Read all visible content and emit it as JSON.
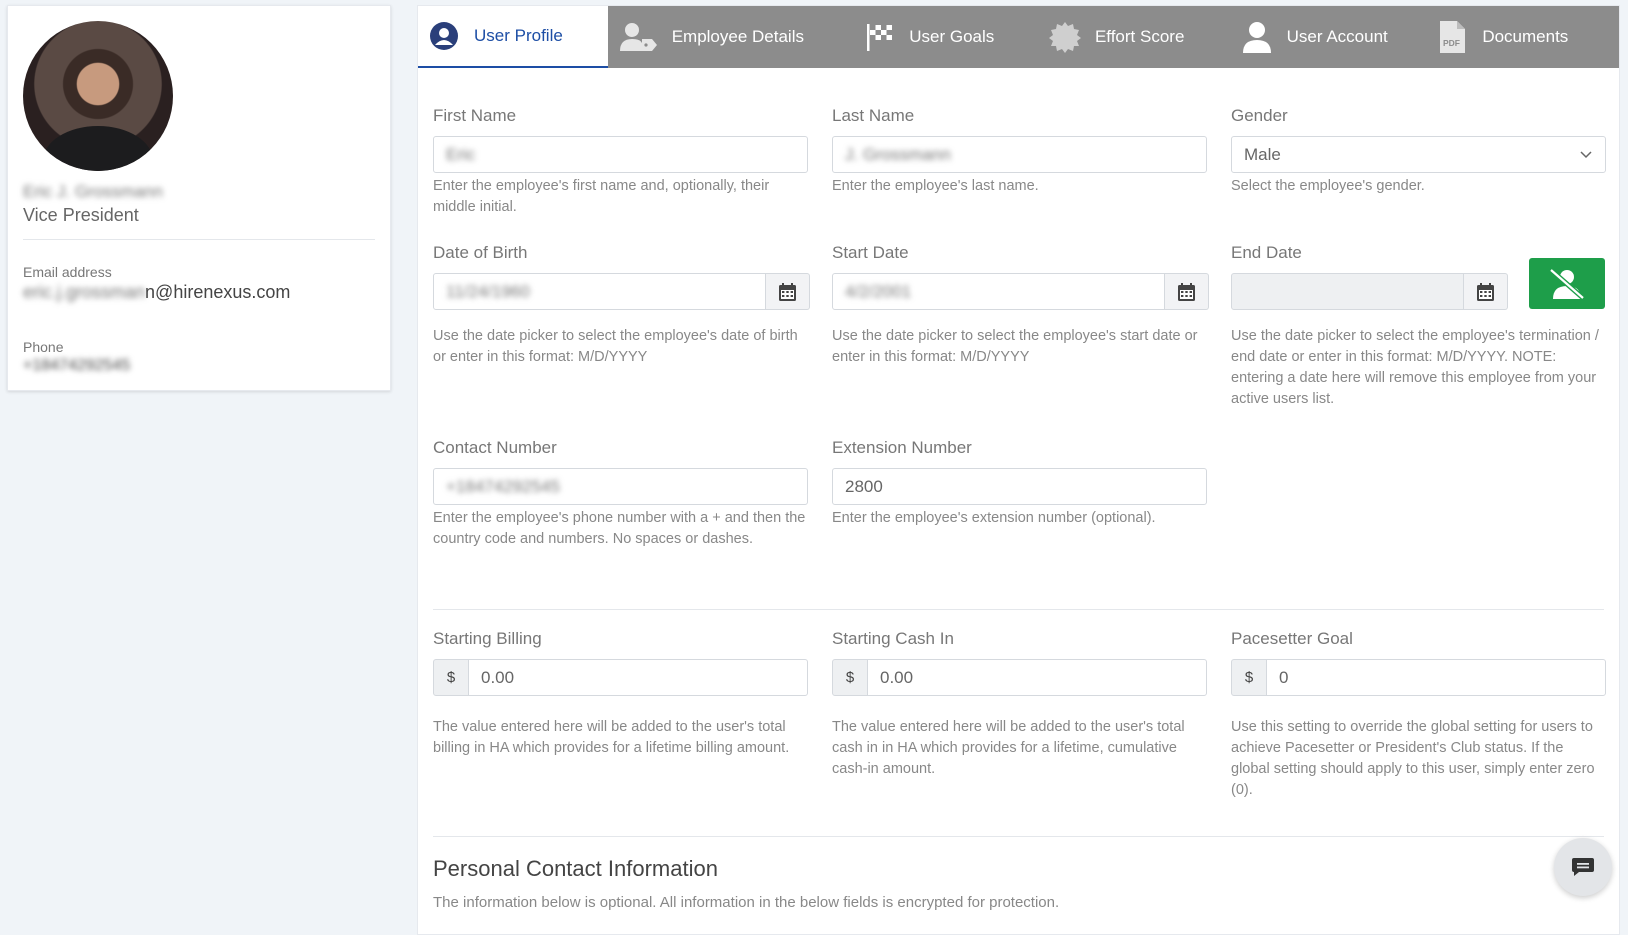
{
  "profile": {
    "name": "Eric J. Grossmann",
    "title": "Vice President",
    "email_label": "Email address",
    "email_blurred": "eric.j.grossman",
    "email_domain": "n@hirenexus.com",
    "phone_label": "Phone",
    "phone": "+18474292545"
  },
  "tabs": [
    {
      "label": "User Profile",
      "icon": "user-circle-icon"
    },
    {
      "label": "Employee Details",
      "icon": "user-tag-icon"
    },
    {
      "label": "User Goals",
      "icon": "flag-checkered-icon"
    },
    {
      "label": "Effort Score",
      "icon": "badge-icon"
    },
    {
      "label": "User Account",
      "icon": "user-icon"
    },
    {
      "label": "Documents",
      "icon": "pdf-file-icon"
    }
  ],
  "form": {
    "first_name": {
      "label": "First Name",
      "value": "Eric",
      "help": "Enter the employee's first name and, optionally, their middle initial."
    },
    "last_name": {
      "label": "Last Name",
      "value": "J. Grossmann",
      "help": "Enter the employee's last name."
    },
    "gender": {
      "label": "Gender",
      "value": "Male",
      "help": "Select the employee's gender."
    },
    "dob": {
      "label": "Date of Birth",
      "value": "11/24/1960",
      "help": "Use the date picker to select the employee's date of birth or enter in this format: M/D/YYYY"
    },
    "start_date": {
      "label": "Start Date",
      "value": "4/2/2001",
      "help": "Use the date picker to select the employee's start date or enter in this format: M/D/YYYY"
    },
    "end_date": {
      "label": "End Date",
      "value": "",
      "help": "Use the date picker to select the employee's termination / end date or enter in this format: M/D/YYYY. NOTE: entering a date here will remove this employee from your active users list."
    },
    "contact": {
      "label": "Contact Number",
      "value": "+18474292545",
      "help": "Enter the employee's phone number with a + and then the country code and numbers. No spaces or dashes."
    },
    "extension": {
      "label": "Extension Number",
      "value": "2800",
      "help": "Enter the employee's extension number (optional)."
    },
    "billing": {
      "label": "Starting Billing",
      "addon": "$",
      "value": "0.00",
      "help": "The value entered here will be added to the user's total billing in HA which provides for a lifetime billing amount."
    },
    "cash_in": {
      "label": "Starting Cash In",
      "addon": "$",
      "value": "0.00",
      "help": "The value entered here will be added to the user's total cash in in HA which provides for a lifetime, cumulative cash-in amount."
    },
    "pacesetter": {
      "label": "Pacesetter Goal",
      "addon": "$",
      "value": "0",
      "help": "Use this setting to override the global setting for users to achieve Pacesetter or President's Club status. If the global setting should apply to this user, simply enter zero (0)."
    }
  },
  "section": {
    "title": "Personal Contact Information",
    "subtitle": "The information below is optional. All information in the below fields is encrypted for protection."
  },
  "colors": {
    "accent": "#1d4ea5",
    "tab_bar": "#8c8c8c",
    "end_date_button": "#1e9e4a"
  }
}
